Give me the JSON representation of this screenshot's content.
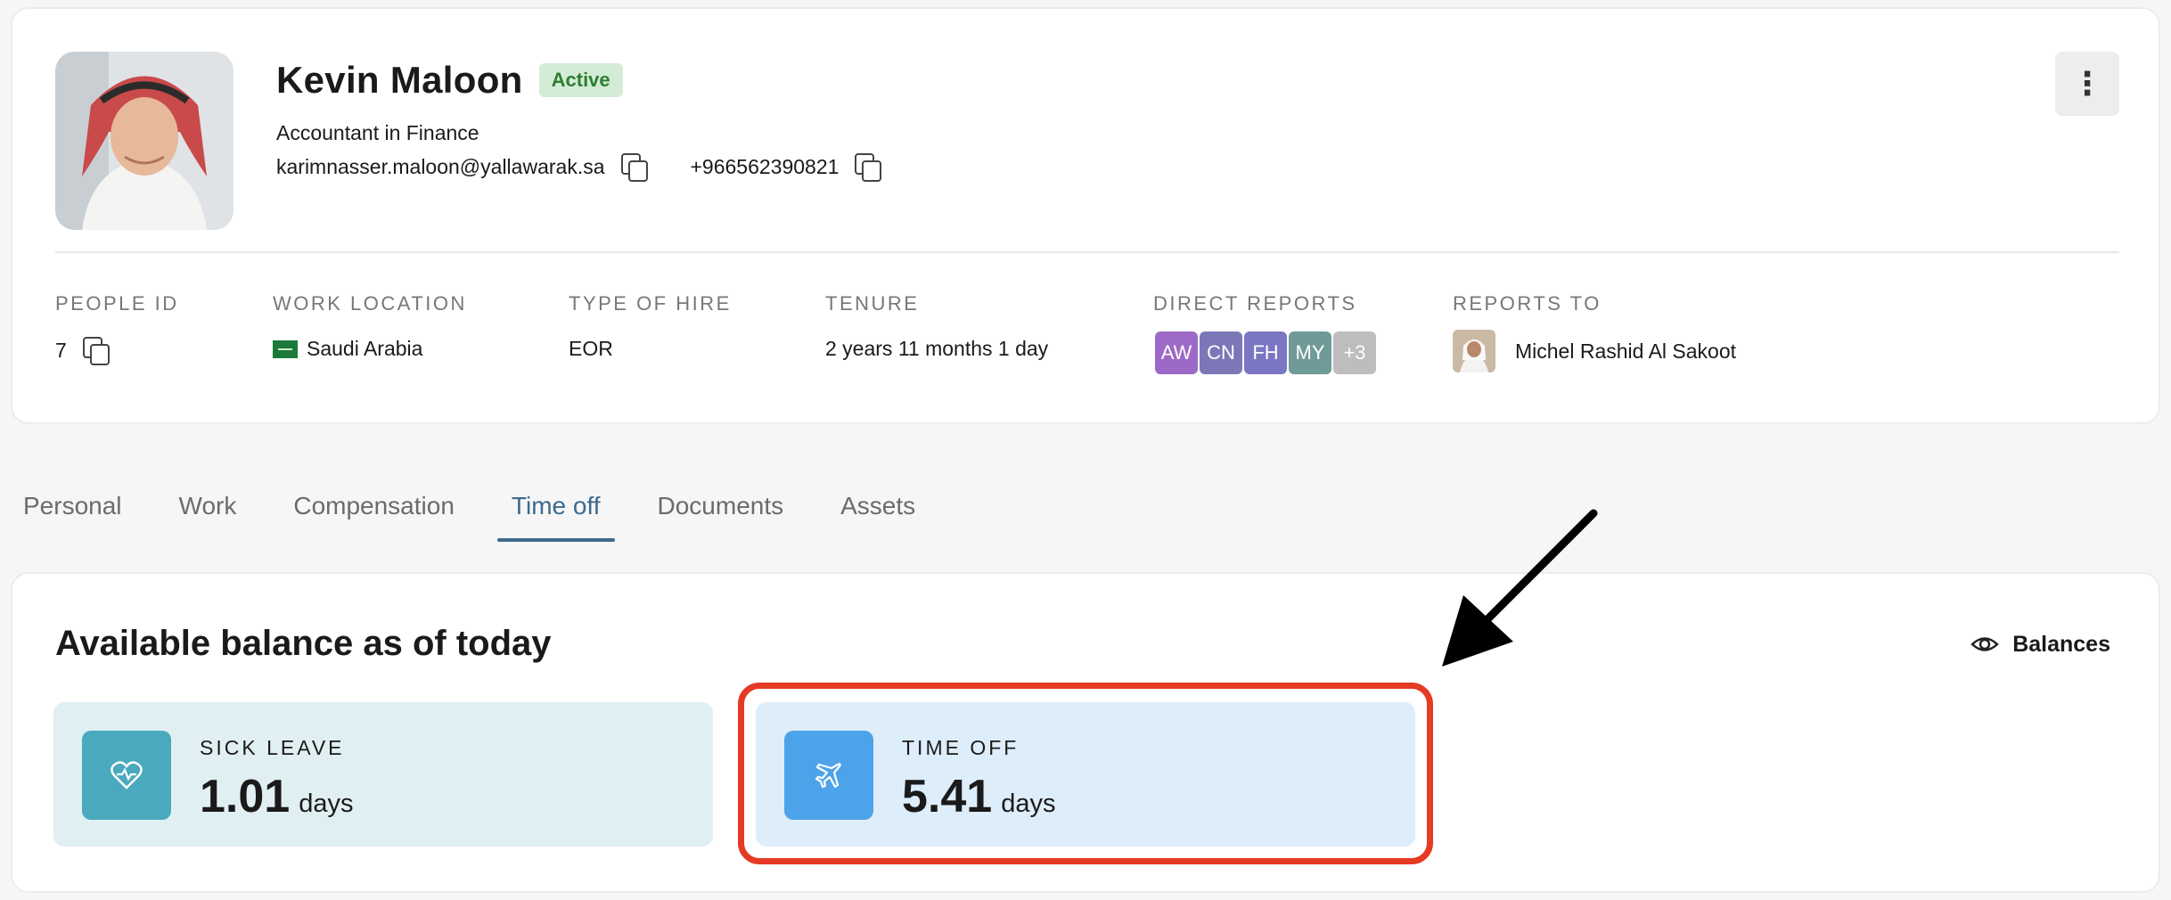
{
  "profile": {
    "name": "Kevin Maloon",
    "status": "Active",
    "job_title": "Accountant in Finance",
    "email": "karimnasser.maloon@yallawarak.sa",
    "phone": "+966562390821"
  },
  "fields": {
    "people_id_label": "PEOPLE ID",
    "people_id": "7",
    "work_location_label": "WORK LOCATION",
    "work_location": "Saudi Arabia",
    "type_of_hire_label": "TYPE OF HIRE",
    "type_of_hire": "EOR",
    "tenure_label": "TENURE",
    "tenure": "2 years 11 months 1 day",
    "direct_reports_label": "DIRECT REPORTS",
    "direct_reports": [
      {
        "initials": "AW",
        "color": "#9c6ac6"
      },
      {
        "initials": "CN",
        "color": "#7c78b8"
      },
      {
        "initials": "FH",
        "color": "#7b76c4"
      },
      {
        "initials": "MY",
        "color": "#6f9a98"
      },
      {
        "initials": "+3",
        "color": "#bdbdbd"
      }
    ],
    "reports_to_label": "REPORTS TO",
    "reports_to": "Michel Rashid Al Sakoot"
  },
  "tabs": [
    "Personal",
    "Work",
    "Compensation",
    "Time off",
    "Documents",
    "Assets"
  ],
  "active_tab": "Time off",
  "balance": {
    "title": "Available balance as of today",
    "toggle_label": "Balances",
    "cards": [
      {
        "type": "SICK LEAVE",
        "amount": "1.01",
        "unit": "days",
        "icon": "heart-pulse-icon",
        "bg": "#e0eff2",
        "icon_bg": "#4aa9bd"
      },
      {
        "type": "TIME OFF",
        "amount": "5.41",
        "unit": "days",
        "icon": "airplane-icon",
        "bg": "#deedfa",
        "icon_bg": "#4da3ea"
      }
    ]
  },
  "colors": {
    "accent_tab": "#3c6a8d",
    "highlight_box": "#e53a24",
    "status_badge_bg": "#d4ecd5",
    "status_badge_text": "#2e7d32"
  }
}
